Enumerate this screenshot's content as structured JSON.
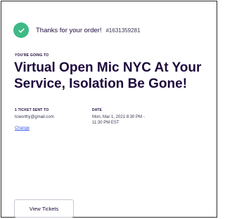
{
  "confirmation": {
    "message": "Thanks for your order!",
    "order_number": "#1631359281"
  },
  "event": {
    "eyebrow": "YOU'RE GOING TO",
    "title": "Virtual Open Mic NYC At Your Service, Isolation Be Gone!"
  },
  "ticket": {
    "label": "1 TICKET SENT TO",
    "email": "tcworthy@gmail.com",
    "change_label": "Change"
  },
  "date": {
    "label": "DATE",
    "line1": "Mon, Mar 1, 2021 8:30 PM -",
    "line2": "11:30 PM EST"
  },
  "actions": {
    "view_tickets_label": "View Tickets"
  },
  "colors": {
    "success": "#3fb985",
    "heading": "#1e0a3c",
    "link": "#3659e3"
  }
}
